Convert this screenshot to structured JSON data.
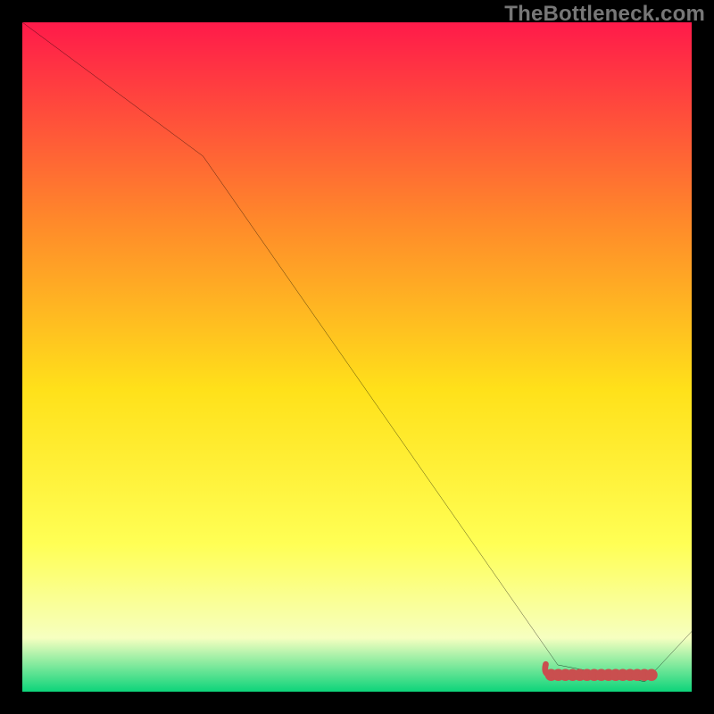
{
  "watermark": "TheBottleneck.com",
  "colors": {
    "bg": "#000000",
    "watermark": "#777777",
    "grad_top": "#ff1a4a",
    "grad_mid1": "#ff8a2a",
    "grad_mid2": "#ffe11a",
    "grad_mid3": "#ffff55",
    "grad_mid4": "#f6ffc0",
    "grad_bottom": "#0dd47a",
    "line": "#000000",
    "region": "#c94f4f"
  },
  "chart_data": {
    "type": "line",
    "title": "",
    "xlabel": "",
    "ylabel": "",
    "xlim": [
      0,
      100
    ],
    "ylim": [
      0,
      100
    ],
    "x": [
      0,
      27,
      80,
      93,
      100
    ],
    "values": [
      100,
      80,
      4,
      1.5,
      9
    ],
    "annotations": [
      {
        "kind": "highlight-region",
        "x0": 79,
        "x1": 94,
        "y": 2.5
      }
    ]
  }
}
